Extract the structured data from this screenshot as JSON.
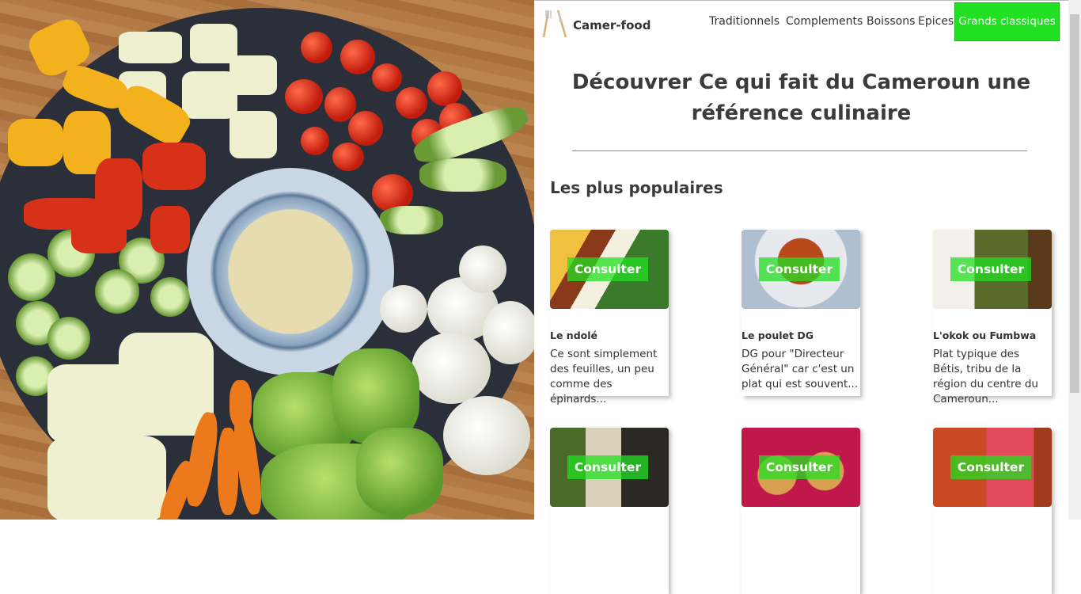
{
  "nav": {
    "brand": "Camer-food",
    "links": [
      "Traditionnels",
      "Complements",
      "Boissons",
      "Epices"
    ],
    "cta": "Grands classiques"
  },
  "hero": {
    "headline": "Découvrer Ce qui fait du Cameroun une référence culinaire"
  },
  "popular": {
    "title": "Les plus populaires",
    "consult_label": "Consulter",
    "cards": [
      {
        "title": "Le ndolé",
        "desc": "Ce sont simplement des feuilles, un peu comme des épinards..."
      },
      {
        "title": "Le poulet DG",
        "desc": "DG pour \"Directeur Général\" car c'est un plat qui est souvent..."
      },
      {
        "title": "L'okok ou Fumbwa",
        "desc": "Plat typique des Bétis, tribu de la région du centre du Cameroun..."
      },
      {
        "title": "",
        "desc": ""
      },
      {
        "title": "",
        "desc": ""
      },
      {
        "title": "",
        "desc": ""
      }
    ]
  },
  "colors": {
    "accent": "#22e022",
    "text": "#333333"
  },
  "icons": [
    "fork-knife-icon"
  ]
}
